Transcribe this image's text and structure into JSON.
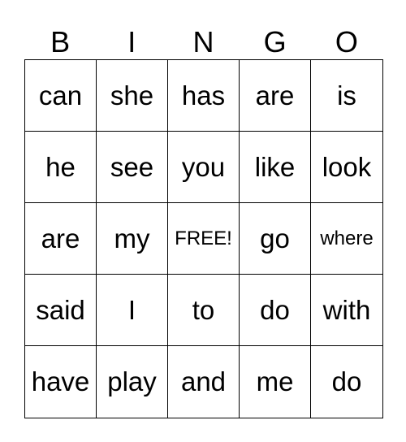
{
  "header": [
    "B",
    "I",
    "N",
    "G",
    "O"
  ],
  "cells": [
    [
      "can",
      "she",
      "has",
      "are",
      "is"
    ],
    [
      "he",
      "see",
      "you",
      "like",
      "look"
    ],
    [
      "are",
      "my",
      "FREE!",
      "go",
      "where"
    ],
    [
      "said",
      "I",
      "to",
      "do",
      "with"
    ],
    [
      "have",
      "play",
      "and",
      "me",
      "do"
    ]
  ]
}
